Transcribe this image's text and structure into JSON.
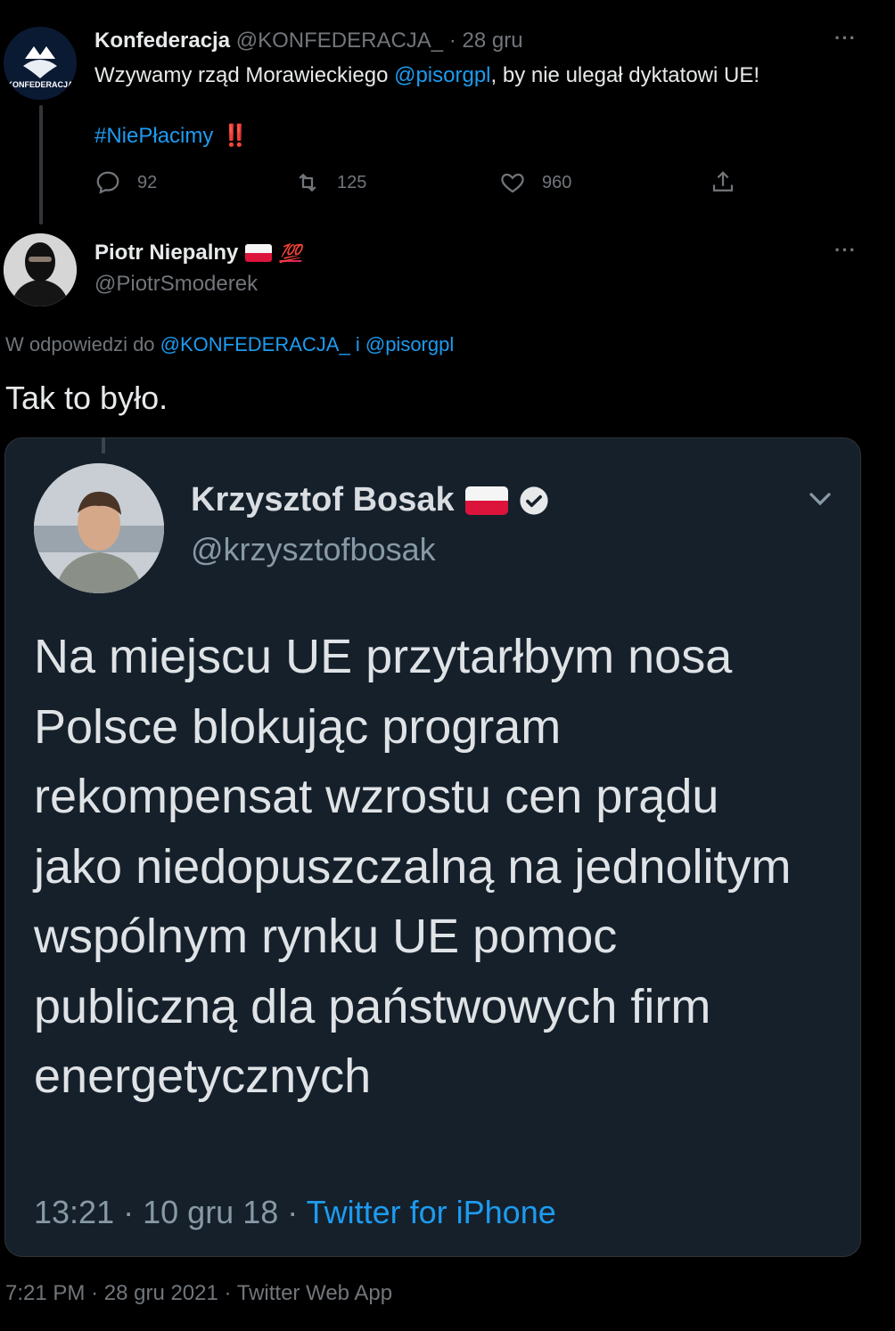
{
  "tweet1": {
    "author_name": "Konfederacja",
    "author_handle": "@KONFEDERACJA_",
    "separator": "·",
    "date": "28 gru",
    "text_before": "Wzywamy rząd Morawieckiego ",
    "mention": "@pisorgpl",
    "text_after": ", by nie ulegał dyktatowi UE!",
    "hashtag": "#NiePłacimy",
    "hashtag_emoji": "‼️",
    "avatar_logo_text": "KONFEDERACJA",
    "reply_count": "92",
    "retweet_count": "125",
    "like_count": "960",
    "more": "···"
  },
  "tweet2": {
    "author_name": "Piotr Niepalny",
    "author_emoji": "💯",
    "author_handle": "@PiotrSmoderek",
    "reply_prefix": "W odpowiedzi do",
    "reply_mention1": "@KONFEDERACJA_",
    "reply_and": "i",
    "reply_mention2": "@pisorgpl",
    "text": "Tak to było.",
    "more": "···",
    "footer_time": "7:21 PM",
    "footer_date": "28 gru 2021",
    "footer_source": "Twitter Web App",
    "footer_sep": "·"
  },
  "embedded": {
    "author_name": "Krzysztof Bosak",
    "author_handle": "@krzysztofbosak",
    "text": "Na miejscu UE przytarłbym nosa Polsce blokując program rekompensat wzrostu cen prądu jako niedopuszczalną na jednolitym wspólnym rynku UE pomoc publiczną dla państwowych firm energetycznych",
    "time": "13:21",
    "date": "10 gru 18",
    "source": "Twitter for iPhone",
    "sep": "·"
  },
  "colors": {
    "background": "#000000",
    "link": "#1d9bf0",
    "muted": "#71767b",
    "embed_bg": "#15202b"
  }
}
